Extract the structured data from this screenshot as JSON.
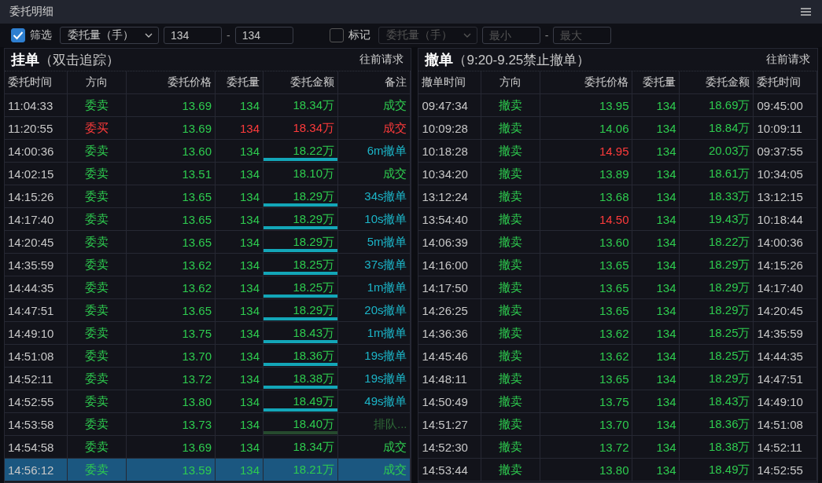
{
  "window": {
    "title": "委托明细"
  },
  "filter": {
    "enabled": {
      "label": "筛选",
      "checked": true
    },
    "field": "委托量（手）",
    "min": "134",
    "separator": "-",
    "max": "134"
  },
  "mark": {
    "label": "标记",
    "checked": false,
    "field": "委托量（手）",
    "min_placeholder": "最小",
    "separator": "-",
    "max_placeholder": "最大"
  },
  "pending": {
    "title": "挂单",
    "subtitle": "（双击追踪）",
    "action": "往前请求",
    "columns": [
      "委托时间",
      "方向",
      "委托价格",
      "委托量",
      "委托金额",
      "备注"
    ],
    "rows": [
      {
        "time": "11:04:33",
        "side": {
          "text": "委卖",
          "kind": "sell"
        },
        "price": "13.69",
        "qty": "134",
        "amount": "18.34万",
        "note": {
          "text": "成交",
          "kind": "filled"
        },
        "selected": false
      },
      {
        "time": "11:20:55",
        "side": {
          "text": "委买",
          "kind": "buy"
        },
        "price": "13.69",
        "qty": "134",
        "amount": "18.34万",
        "note": {
          "text": "成交",
          "kind": "filled"
        },
        "selected": false
      },
      {
        "time": "14:00:36",
        "side": {
          "text": "委卖",
          "kind": "sell"
        },
        "price": "13.60",
        "qty": "134",
        "amount": "18.22万",
        "note": {
          "text": "6m撤单",
          "kind": "cancel"
        },
        "selected": false
      },
      {
        "time": "14:02:15",
        "side": {
          "text": "委卖",
          "kind": "sell"
        },
        "price": "13.51",
        "qty": "134",
        "amount": "18.10万",
        "note": {
          "text": "成交",
          "kind": "filled"
        },
        "selected": false
      },
      {
        "time": "14:15:26",
        "side": {
          "text": "委卖",
          "kind": "sell"
        },
        "price": "13.65",
        "qty": "134",
        "amount": "18.29万",
        "note": {
          "text": "34s撤单",
          "kind": "cancel"
        },
        "selected": false
      },
      {
        "time": "14:17:40",
        "side": {
          "text": "委卖",
          "kind": "sell"
        },
        "price": "13.65",
        "qty": "134",
        "amount": "18.29万",
        "note": {
          "text": "10s撤单",
          "kind": "cancel"
        },
        "selected": false
      },
      {
        "time": "14:20:45",
        "side": {
          "text": "委卖",
          "kind": "sell"
        },
        "price": "13.65",
        "qty": "134",
        "amount": "18.29万",
        "note": {
          "text": "5m撤单",
          "kind": "cancel"
        },
        "selected": false
      },
      {
        "time": "14:35:59",
        "side": {
          "text": "委卖",
          "kind": "sell"
        },
        "price": "13.62",
        "qty": "134",
        "amount": "18.25万",
        "note": {
          "text": "37s撤单",
          "kind": "cancel"
        },
        "selected": false
      },
      {
        "time": "14:44:35",
        "side": {
          "text": "委卖",
          "kind": "sell"
        },
        "price": "13.62",
        "qty": "134",
        "amount": "18.25万",
        "note": {
          "text": "1m撤单",
          "kind": "cancel"
        },
        "selected": false
      },
      {
        "time": "14:47:51",
        "side": {
          "text": "委卖",
          "kind": "sell"
        },
        "price": "13.65",
        "qty": "134",
        "amount": "18.29万",
        "note": {
          "text": "20s撤单",
          "kind": "cancel"
        },
        "selected": false
      },
      {
        "time": "14:49:10",
        "side": {
          "text": "委卖",
          "kind": "sell"
        },
        "price": "13.75",
        "qty": "134",
        "amount": "18.43万",
        "note": {
          "text": "1m撤单",
          "kind": "cancel"
        },
        "selected": false
      },
      {
        "time": "14:51:08",
        "side": {
          "text": "委卖",
          "kind": "sell"
        },
        "price": "13.70",
        "qty": "134",
        "amount": "18.36万",
        "note": {
          "text": "19s撤单",
          "kind": "cancel"
        },
        "selected": false
      },
      {
        "time": "14:52:11",
        "side": {
          "text": "委卖",
          "kind": "sell"
        },
        "price": "13.72",
        "qty": "134",
        "amount": "18.38万",
        "note": {
          "text": "19s撤单",
          "kind": "cancel"
        },
        "selected": false
      },
      {
        "time": "14:52:55",
        "side": {
          "text": "委卖",
          "kind": "sell"
        },
        "price": "13.80",
        "qty": "134",
        "amount": "18.49万",
        "note": {
          "text": "49s撤单",
          "kind": "cancel"
        },
        "selected": false
      },
      {
        "time": "14:53:58",
        "side": {
          "text": "委卖",
          "kind": "sell"
        },
        "price": "13.73",
        "qty": "134",
        "amount": "18.40万",
        "note": {
          "text": "排队...",
          "kind": "queue"
        },
        "selected": false
      },
      {
        "time": "14:54:58",
        "side": {
          "text": "委卖",
          "kind": "sell"
        },
        "price": "13.69",
        "qty": "134",
        "amount": "18.34万",
        "note": {
          "text": "成交",
          "kind": "filled"
        },
        "selected": false
      },
      {
        "time": "14:56:12",
        "side": {
          "text": "委卖",
          "kind": "sell"
        },
        "price": "13.59",
        "qty": "134",
        "amount": "18.21万",
        "note": {
          "text": "成交",
          "kind": "filled"
        },
        "selected": true
      }
    ]
  },
  "cancelled": {
    "title": "撤单",
    "subtitle": "（9:20-9.25禁止撤单）",
    "action": "往前请求",
    "columns": [
      "撤单时间",
      "方向",
      "委托价格",
      "委托量",
      "委托金额",
      "委托时间"
    ],
    "rows": [
      {
        "time": "09:47:34",
        "side": "撤卖",
        "price": "13.95",
        "price_up": false,
        "qty": "134",
        "amount": "18.69万",
        "order_time": "09:45:00"
      },
      {
        "time": "10:09:28",
        "side": "撤卖",
        "price": "14.06",
        "price_up": false,
        "qty": "134",
        "amount": "18.84万",
        "order_time": "10:09:11"
      },
      {
        "time": "10:18:28",
        "side": "撤卖",
        "price": "14.95",
        "price_up": true,
        "qty": "134",
        "amount": "20.03万",
        "order_time": "09:37:55"
      },
      {
        "time": "10:34:20",
        "side": "撤卖",
        "price": "13.89",
        "price_up": false,
        "qty": "134",
        "amount": "18.61万",
        "order_time": "10:34:05"
      },
      {
        "time": "13:12:24",
        "side": "撤卖",
        "price": "13.68",
        "price_up": false,
        "qty": "134",
        "amount": "18.33万",
        "order_time": "13:12:15"
      },
      {
        "time": "13:54:40",
        "side": "撤卖",
        "price": "14.50",
        "price_up": true,
        "qty": "134",
        "amount": "19.43万",
        "order_time": "10:18:44"
      },
      {
        "time": "14:06:39",
        "side": "撤卖",
        "price": "13.60",
        "price_up": false,
        "qty": "134",
        "amount": "18.22万",
        "order_time": "14:00:36"
      },
      {
        "time": "14:16:00",
        "side": "撤卖",
        "price": "13.65",
        "price_up": false,
        "qty": "134",
        "amount": "18.29万",
        "order_time": "14:15:26"
      },
      {
        "time": "14:17:50",
        "side": "撤卖",
        "price": "13.65",
        "price_up": false,
        "qty": "134",
        "amount": "18.29万",
        "order_time": "14:17:40"
      },
      {
        "time": "14:26:25",
        "side": "撤卖",
        "price": "13.65",
        "price_up": false,
        "qty": "134",
        "amount": "18.29万",
        "order_time": "14:20:45"
      },
      {
        "time": "14:36:36",
        "side": "撤卖",
        "price": "13.62",
        "price_up": false,
        "qty": "134",
        "amount": "18.25万",
        "order_time": "14:35:59"
      },
      {
        "time": "14:45:46",
        "side": "撤卖",
        "price": "13.62",
        "price_up": false,
        "qty": "134",
        "amount": "18.25万",
        "order_time": "14:44:35"
      },
      {
        "time": "14:48:11",
        "side": "撤卖",
        "price": "13.65",
        "price_up": false,
        "qty": "134",
        "amount": "18.29万",
        "order_time": "14:47:51"
      },
      {
        "time": "14:50:49",
        "side": "撤卖",
        "price": "13.75",
        "price_up": false,
        "qty": "134",
        "amount": "18.43万",
        "order_time": "14:49:10"
      },
      {
        "time": "14:51:27",
        "side": "撤卖",
        "price": "13.70",
        "price_up": false,
        "qty": "134",
        "amount": "18.36万",
        "order_time": "14:51:08"
      },
      {
        "time": "14:52:30",
        "side": "撤卖",
        "price": "13.72",
        "price_up": false,
        "qty": "134",
        "amount": "18.38万",
        "order_time": "14:52:11"
      },
      {
        "time": "14:53:44",
        "side": "撤卖",
        "price": "13.80",
        "price_up": false,
        "qty": "134",
        "amount": "18.49万",
        "order_time": "14:52:55"
      }
    ]
  }
}
